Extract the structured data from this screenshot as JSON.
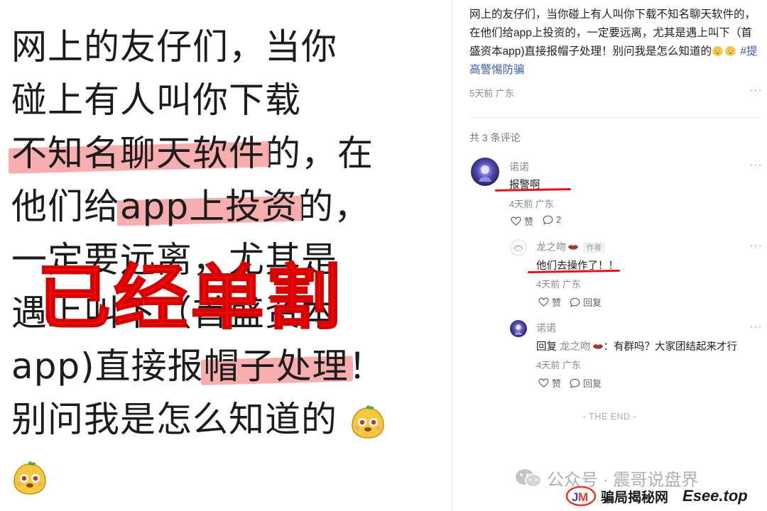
{
  "left": {
    "lines": [
      "网上的友仔们，当你",
      "碰上有人叫你下载",
      "不知名聊天软件",
      "的，在",
      "他们给",
      "app上投资",
      "的，",
      "一定要远离，尤其是",
      "遇上叫下（首盛资本",
      "app)直接报",
      "帽子处理",
      "！",
      "别问我是怎么知道的"
    ],
    "stamp": "已经单割"
  },
  "post": {
    "text": "网上的友仔们，当你碰上有人叫你下载不知名聊天软件的，在他们给app上投资的，一定要远离，尤其是遇上叫下（首盛资本app)直接报帽子处理！别问我是怎么知道的",
    "hashtag": "#提高警惕防骗",
    "meta": "5天前 广东",
    "more": "···"
  },
  "comments": {
    "count_label": "共 3 条评论",
    "items": [
      {
        "name": "诺诺",
        "text": "报警啊",
        "meta": "4天前 广东",
        "like": "赞",
        "reply_count": "2",
        "more": "···"
      },
      {
        "name": "龙之吻",
        "badge": "作者",
        "text": "他们去操作了！！",
        "meta": "4天前 广东",
        "like": "赞",
        "reply": "回复",
        "more": "···"
      },
      {
        "name": "诺诺",
        "reply_prefix": "回复",
        "reply_to": "龙之吻",
        "text": "：有群吗？大家团结起来才行",
        "meta": "4天前 广东",
        "like": "赞",
        "reply": "回复",
        "more": "···"
      }
    ]
  },
  "end_label": "- THE END -",
  "watermark": {
    "account": "公众号 · 震哥说盘界",
    "site_cn": "骗局揭秘网",
    "site_en": "Esee.top"
  },
  "colors": {
    "highlight": "#f7a0a0",
    "stamp": "#f20d0d",
    "underline": "#e8101a",
    "hashtag": "#3a5ca8"
  }
}
